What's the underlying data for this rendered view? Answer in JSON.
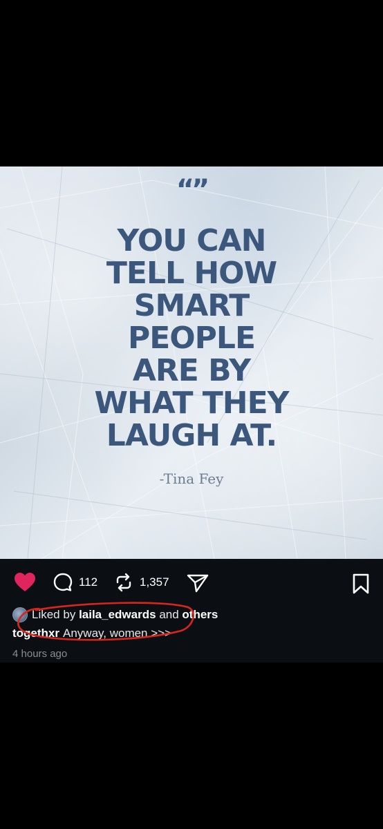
{
  "post": {
    "quote_marks": "“”",
    "quote_lines": [
      "YOU CAN",
      "TELL HOW",
      "SMART",
      "PEOPLE",
      "ARE BY",
      "WHAT THEY",
      "LAUGH AT."
    ],
    "author": "-Tina Fey",
    "text_color": "#3b577c"
  },
  "actions": {
    "like_icon": "heart-filled-icon",
    "like_color": "#e0245e",
    "comment_icon": "comment-bubble-icon",
    "comment_count": "112",
    "repost_icon": "repost-arrows-icon",
    "repost_count": "1,357",
    "share_icon": "paper-plane-icon",
    "save_icon": "bookmark-icon"
  },
  "likes": {
    "prefix": "Liked by",
    "user": "laila_edwards",
    "and": "and",
    "suffix": "others"
  },
  "caption": {
    "user": "togethxr",
    "text": "Anyway, women >>>"
  },
  "timestamp": "4 hours ago",
  "annotation_color": "#d9261c"
}
